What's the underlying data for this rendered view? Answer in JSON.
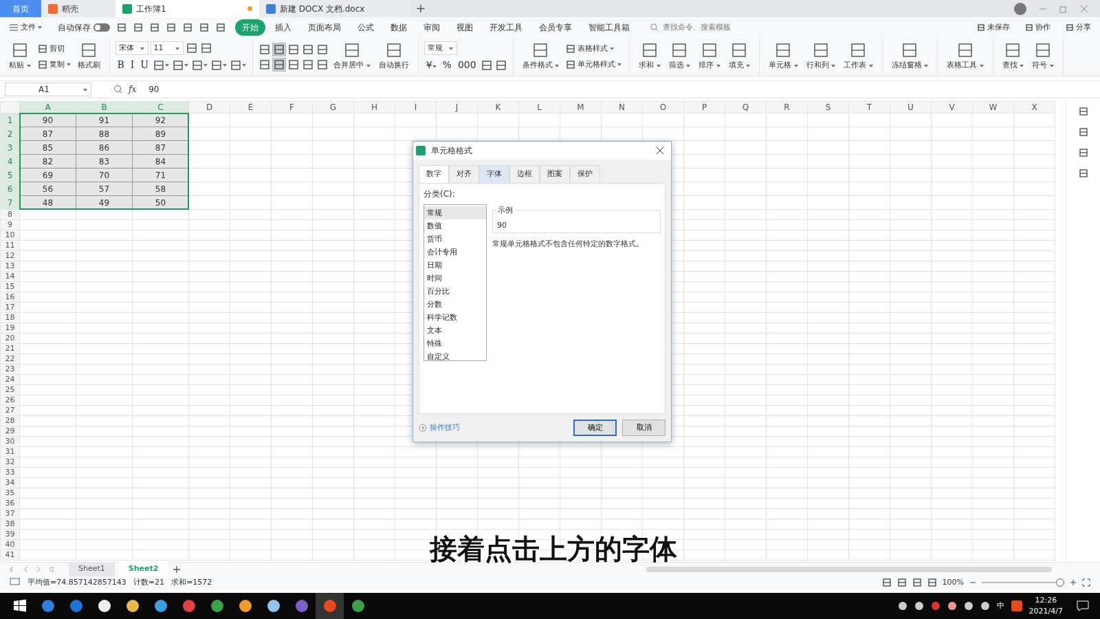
{
  "tabs": [
    {
      "label": "首页",
      "selected": false,
      "kind": "home",
      "unsaved": false
    },
    {
      "label": "稻壳",
      "selected": false,
      "kind": "docer",
      "unsaved": false
    },
    {
      "label": "工作簿1",
      "selected": true,
      "kind": "sheet",
      "unsaved": true
    },
    {
      "label": "新建 DOCX 文档.docx",
      "selected": false,
      "kind": "doc",
      "unsaved": false
    }
  ],
  "menu": {
    "file": "文件",
    "autosave": {
      "label": "自动保存",
      "on": false
    },
    "tabs": [
      {
        "label": "开始",
        "selected": true
      },
      {
        "label": "插入",
        "selected": false
      },
      {
        "label": "页面布局",
        "selected": false
      },
      {
        "label": "公式",
        "selected": false
      },
      {
        "label": "数据",
        "selected": false
      },
      {
        "label": "审阅",
        "selected": false
      },
      {
        "label": "视图",
        "selected": false
      },
      {
        "label": "开发工具",
        "selected": false
      },
      {
        "label": "会员专享",
        "selected": false
      },
      {
        "label": "智能工具箱",
        "selected": false
      }
    ],
    "search": {
      "placeholder": "查找命令、搜索模板"
    },
    "actions": [
      "未保存",
      "协作",
      "分享"
    ]
  },
  "ribbon": [
    {
      "items": [
        {
          "kind": "big",
          "label": "粘贴",
          "dropdown": true
        },
        {
          "kind": "stack",
          "lines": [
            {
              "items": [
                {
                  "kind": "small",
                  "label": "剪切",
                  "dropdown": false
                }
              ]
            },
            {
              "items": [
                {
                  "kind": "small",
                  "label": "复制",
                  "dropdown": true
                }
              ]
            }
          ]
        },
        {
          "kind": "big",
          "label": "格式刷",
          "dropdown": false
        }
      ]
    },
    {
      "items": [
        {
          "kind": "stack",
          "lines": [
            {
              "items": [
                {
                  "kind": "select",
                  "value": "宋体"
                },
                {
                  "kind": "select",
                  "value": "11"
                },
                {
                  "kind": "icon",
                  "dropdown": false
                },
                {
                  "kind": "icon",
                  "dropdown": false
                }
              ]
            },
            {
              "items": [
                {
                  "kind": "glyph",
                  "label": "B",
                  "dropdown": false
                },
                {
                  "kind": "glyph",
                  "label": "I",
                  "dropdown": false
                },
                {
                  "kind": "glyph",
                  "label": "U",
                  "dropdown": false
                },
                {
                  "kind": "icon",
                  "dropdown": true
                },
                {
                  "kind": "icon",
                  "dropdown": true
                },
                {
                  "kind": "icon",
                  "dropdown": true
                },
                {
                  "kind": "icon",
                  "dropdown": true
                },
                {
                  "kind": "icon",
                  "dropdown": true
                }
              ]
            }
          ]
        }
      ]
    },
    {
      "items": [
        {
          "kind": "stack",
          "lines": [
            {
              "items": [
                {
                  "kind": "icon",
                  "pressed": false
                },
                {
                  "kind": "icon",
                  "pressed": true
                },
                {
                  "kind": "icon",
                  "pressed": false
                },
                {
                  "kind": "icon",
                  "pressed": false
                },
                {
                  "kind": "icon",
                  "pressed": false
                }
              ]
            },
            {
              "items": [
                {
                  "kind": "icon",
                  "pressed": false
                },
                {
                  "kind": "icon",
                  "pressed": true
                },
                {
                  "kind": "icon",
                  "pressed": false
                },
                {
                  "kind": "icon",
                  "pressed": false
                },
                {
                  "kind": "icon",
                  "pressed": false
                }
              ]
            }
          ]
        },
        {
          "kind": "big",
          "label": "合并居中",
          "dropdown": true
        },
        {
          "kind": "big",
          "label": "自动换行",
          "dropdown": false
        }
      ]
    },
    {
      "items": [
        {
          "kind": "stack",
          "lines": [
            {
              "items": [
                {
                  "kind": "select",
                  "value": "常规"
                }
              ]
            },
            {
              "items": [
                {
                  "kind": "glyph",
                  "label": "¥",
                  "dropdown": true
                },
                {
                  "kind": "glyph",
                  "label": "%",
                  "dropdown": false
                },
                {
                  "kind": "glyph",
                  "label": "000",
                  "dropdown": false
                },
                {
                  "kind": "icon",
                  "dropdown": false
                },
                {
                  "kind": "icon",
                  "dropdown": false
                }
              ]
            }
          ]
        }
      ]
    },
    {
      "items": [
        {
          "kind": "big",
          "label": "条件格式",
          "dropdown": true
        },
        {
          "kind": "stack",
          "lines": [
            {
              "items": [
                {
                  "kind": "small",
                  "label": "表格样式",
                  "dropdown": true
                }
              ]
            },
            {
              "items": [
                {
                  "kind": "small",
                  "label": "单元格样式",
                  "dropdown": true
                }
              ]
            }
          ]
        }
      ]
    },
    {
      "items": [
        {
          "kind": "big",
          "label": "求和",
          "dropdown": true
        },
        {
          "kind": "big",
          "label": "筛选",
          "dropdown": true
        },
        {
          "kind": "big",
          "label": "排序",
          "dropdown": true
        },
        {
          "kind": "big",
          "label": "填充",
          "dropdown": true
        }
      ]
    },
    {
      "items": [
        {
          "kind": "big",
          "label": "单元格",
          "dropdown": true
        },
        {
          "kind": "big",
          "label": "行和列",
          "dropdown": true
        },
        {
          "kind": "big",
          "label": "工作表",
          "dropdown": true
        }
      ]
    },
    {
      "items": [
        {
          "kind": "big",
          "label": "冻结窗格",
          "dropdown": true
        }
      ]
    },
    {
      "items": [
        {
          "kind": "big",
          "label": "表格工具",
          "dropdown": true
        }
      ]
    },
    {
      "items": [
        {
          "kind": "big",
          "label": "查找",
          "dropdown": true
        },
        {
          "kind": "big",
          "label": "符号",
          "dropdown": true
        }
      ]
    }
  ],
  "formula_bar": {
    "cell": "A1",
    "fx": "fx",
    "value": "90"
  },
  "columns": [
    {
      "label": "A",
      "selected": true
    },
    {
      "label": "B",
      "selected": true
    },
    {
      "label": "C",
      "selected": true
    },
    {
      "label": "D",
      "selected": false
    },
    {
      "label": "E",
      "selected": false
    },
    {
      "label": "F",
      "selected": false
    },
    {
      "label": "G",
      "selected": false
    },
    {
      "label": "H",
      "selected": false
    },
    {
      "label": "I",
      "selected": false
    },
    {
      "label": "J",
      "selected": false
    },
    {
      "label": "K",
      "selected": false
    },
    {
      "label": "L",
      "selected": false
    },
    {
      "label": "M",
      "selected": false
    },
    {
      "label": "N",
      "selected": false
    },
    {
      "label": "O",
      "selected": false
    },
    {
      "label": "P",
      "selected": false
    },
    {
      "label": "Q",
      "selected": false
    },
    {
      "label": "R",
      "selected": false
    },
    {
      "label": "S",
      "selected": false
    },
    {
      "label": "T",
      "selected": false
    },
    {
      "label": "U",
      "selected": false
    },
    {
      "label": "V",
      "selected": false
    },
    {
      "label": "W",
      "selected": false
    },
    {
      "label": "X",
      "selected": false
    }
  ],
  "rows": [
    {
      "label": "1",
      "selected": true,
      "cells": [
        "90",
        "91",
        "92"
      ]
    },
    {
      "label": "2",
      "selected": true,
      "cells": [
        "87",
        "88",
        "89"
      ]
    },
    {
      "label": "3",
      "selected": true,
      "cells": [
        "85",
        "86",
        "87"
      ]
    },
    {
      "label": "4",
      "selected": true,
      "cells": [
        "82",
        "83",
        "84"
      ]
    },
    {
      "label": "5",
      "selected": true,
      "cells": [
        "69",
        "70",
        "71"
      ]
    },
    {
      "label": "6",
      "selected": true,
      "cells": [
        "56",
        "57",
        "58"
      ]
    },
    {
      "label": "7",
      "selected": true,
      "cells": [
        "48",
        "49",
        "50"
      ]
    },
    {
      "label": "8",
      "selected": false
    },
    {
      "label": "9",
      "selected": false
    },
    {
      "label": "10",
      "selected": false
    },
    {
      "label": "11",
      "selected": false
    },
    {
      "label": "12",
      "selected": false
    },
    {
      "label": "13",
      "selected": false
    },
    {
      "label": "14",
      "selected": false
    },
    {
      "label": "15",
      "selected": false
    },
    {
      "label": "16",
      "selected": false
    },
    {
      "label": "17",
      "selected": false
    },
    {
      "label": "18",
      "selected": false
    },
    {
      "label": "19",
      "selected": false
    },
    {
      "label": "20",
      "selected": false
    },
    {
      "label": "21",
      "selected": false
    },
    {
      "label": "22",
      "selected": false
    },
    {
      "label": "23",
      "selected": false
    },
    {
      "label": "24",
      "selected": false
    },
    {
      "label": "25",
      "selected": false
    },
    {
      "label": "26",
      "selected": false
    },
    {
      "label": "27",
      "selected": false
    },
    {
      "label": "28",
      "selected": false
    },
    {
      "label": "29",
      "selected": false
    },
    {
      "label": "30",
      "selected": false
    },
    {
      "label": "31",
      "selected": false
    },
    {
      "label": "32",
      "selected": false
    },
    {
      "label": "33",
      "selected": false
    },
    {
      "label": "34",
      "selected": false
    },
    {
      "label": "35",
      "selected": false
    },
    {
      "label": "36",
      "selected": false
    },
    {
      "label": "37",
      "selected": false
    },
    {
      "label": "38",
      "selected": false
    },
    {
      "label": "39",
      "selected": false
    },
    {
      "label": "40",
      "selected": false
    },
    {
      "label": "41",
      "selected": false
    }
  ],
  "sheet_tabs": [
    {
      "label": "Sheet1",
      "selected": false
    },
    {
      "label": "Sheet2",
      "selected": true
    }
  ],
  "status_bar": {
    "stats": [
      "平均值=74.857142857143",
      "计数=21",
      "求和=1572"
    ],
    "zoom": "100%",
    "zoom_slider": {
      "level": 0.95
    }
  },
  "dialog": {
    "title": "单元格格式",
    "tabs": [
      {
        "label": "数字",
        "selected": true,
        "hovered": false
      },
      {
        "label": "对齐",
        "selected": false,
        "hovered": false
      },
      {
        "label": "字体",
        "selected": false,
        "hovered": true
      },
      {
        "label": "边框",
        "selected": false,
        "hovered": false
      },
      {
        "label": "图案",
        "selected": false,
        "hovered": false
      },
      {
        "label": "保护",
        "selected": false,
        "hovered": false
      }
    ],
    "category_label": "分类(C):",
    "categories": [
      {
        "label": "常规",
        "selected": true
      },
      {
        "label": "数值",
        "selected": false
      },
      {
        "label": "货币",
        "selected": false
      },
      {
        "label": "会计专用",
        "selected": false
      },
      {
        "label": "日期",
        "selected": false
      },
      {
        "label": "时间",
        "selected": false
      },
      {
        "label": "百分比",
        "selected": false
      },
      {
        "label": "分数",
        "selected": false
      },
      {
        "label": "科学记数",
        "selected": false
      },
      {
        "label": "文本",
        "selected": false
      },
      {
        "label": "特殊",
        "selected": false
      },
      {
        "label": "自定义",
        "selected": false
      }
    ],
    "sample_label": "示例",
    "sample_value": "90",
    "description": "常规单元格格式不包含任何特定的数字格式。",
    "help_link": "操作技巧",
    "buttons": [
      {
        "label": "确定",
        "default": true
      },
      {
        "label": "取消",
        "default": false
      }
    ]
  },
  "caption": "接着点击上方的字体",
  "taskbar": {
    "ime": "中",
    "time": "12:26",
    "date": "2021/4/7"
  }
}
